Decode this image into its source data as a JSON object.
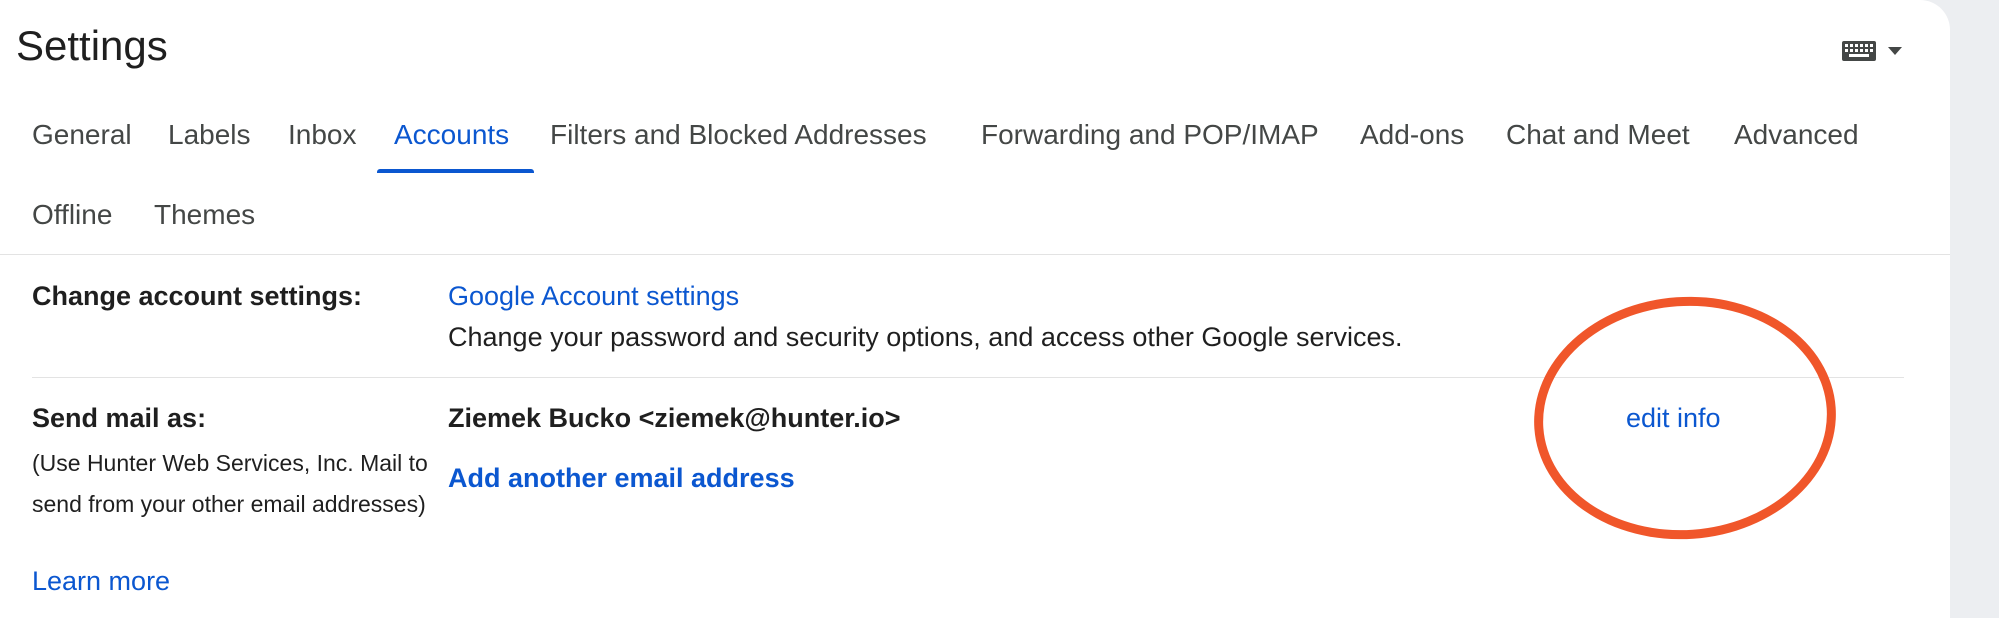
{
  "page": {
    "title": "Settings"
  },
  "toolbar": {
    "keyboard_icon": "keyboard-icon",
    "dropdown_icon": "caret-down-icon"
  },
  "tabs": [
    {
      "label": "General"
    },
    {
      "label": "Labels"
    },
    {
      "label": "Inbox"
    },
    {
      "label": "Accounts",
      "active": true
    },
    {
      "label": "Filters and Blocked Addresses"
    },
    {
      "label": "Forwarding and POP/IMAP"
    },
    {
      "label": "Add-ons"
    },
    {
      "label": "Chat and Meet"
    },
    {
      "label": "Advanced"
    },
    {
      "label": "Offline"
    },
    {
      "label": "Themes"
    }
  ],
  "change_account": {
    "label": "Change account settings:",
    "link": "Google Account settings",
    "description": "Change your password and security options, and access other Google services."
  },
  "send_mail_as": {
    "label": "Send mail as:",
    "note": "(Use Hunter Web Services, Inc. Mail to send from your other email addresses)",
    "learn_more": "Learn more",
    "address": "Ziemek Bucko <ziemek@hunter.io>",
    "add_address": "Add another email address",
    "edit_info": "edit info"
  },
  "colors": {
    "accent": "#0b57d0",
    "highlight": "#f0562a"
  }
}
